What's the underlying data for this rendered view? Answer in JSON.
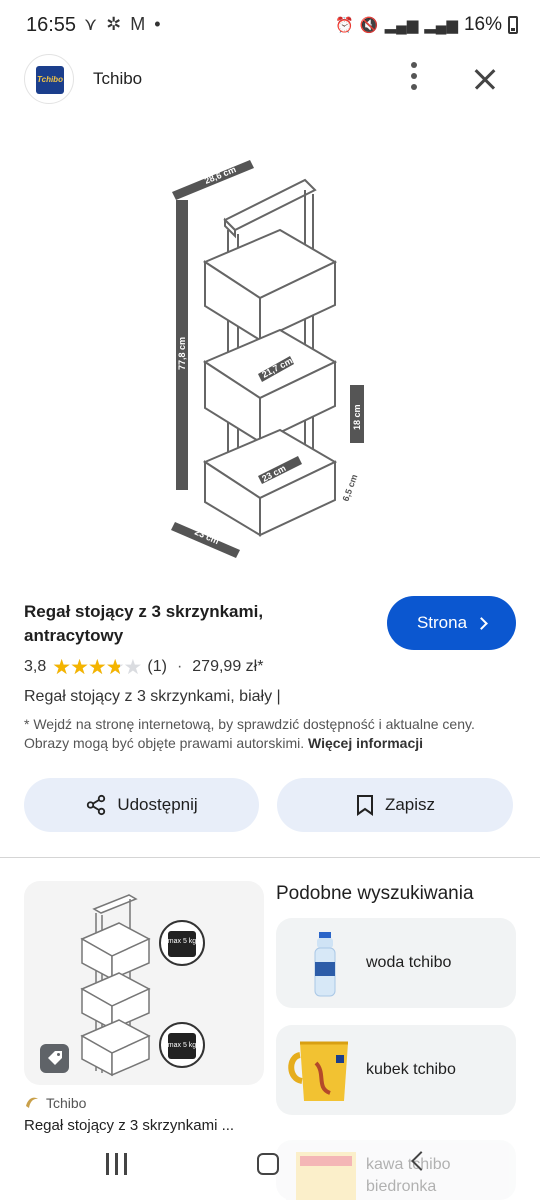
{
  "status_bar": {
    "time": "16:55",
    "left_icons": "⋎ ✲ M •",
    "battery_text": "16%"
  },
  "header": {
    "site_name": "Tchibo",
    "logo_text": "Tchibo"
  },
  "main_image": {
    "dimension_labels": [
      "28,6 cm",
      "77,8 cm",
      "21,7 cm",
      "18 cm",
      "23 cm",
      "6,5 cm",
      "23 cm"
    ]
  },
  "product": {
    "title": "Regał stojący z 3 skrzynkami, antracytowy",
    "visit_button_label": "Strona",
    "rating": "3,8",
    "rating_fraction": 0.76,
    "review_count": "(1)",
    "price": "279,99 zł*",
    "alt_title": "Regał stojący z 3 skrzynkami, biały |",
    "disclaimer": "* Wejdź na stronę internetową, by sprawdzić dostępność i aktualne ceny. Obrazy mogą być objęte prawami autorskimi.",
    "more_info_label": "Więcej informacji"
  },
  "actions": {
    "share_label": "Udostępnij",
    "save_label": "Zapisz"
  },
  "related": {
    "source": "Tchibo",
    "title": "Regał stojący z 3 skrzynkami ...",
    "weight_label": "max 5 kg"
  },
  "similar": {
    "heading": "Podobne wyszukiwania",
    "items": [
      {
        "label": "woda tchibo"
      },
      {
        "label": "kubek tchibo"
      },
      {
        "label": "kawa tchibo biedronka"
      }
    ]
  },
  "colors": {
    "accent": "#0b57d0",
    "action_bg": "#e8eef9",
    "star": "#f4b400"
  }
}
